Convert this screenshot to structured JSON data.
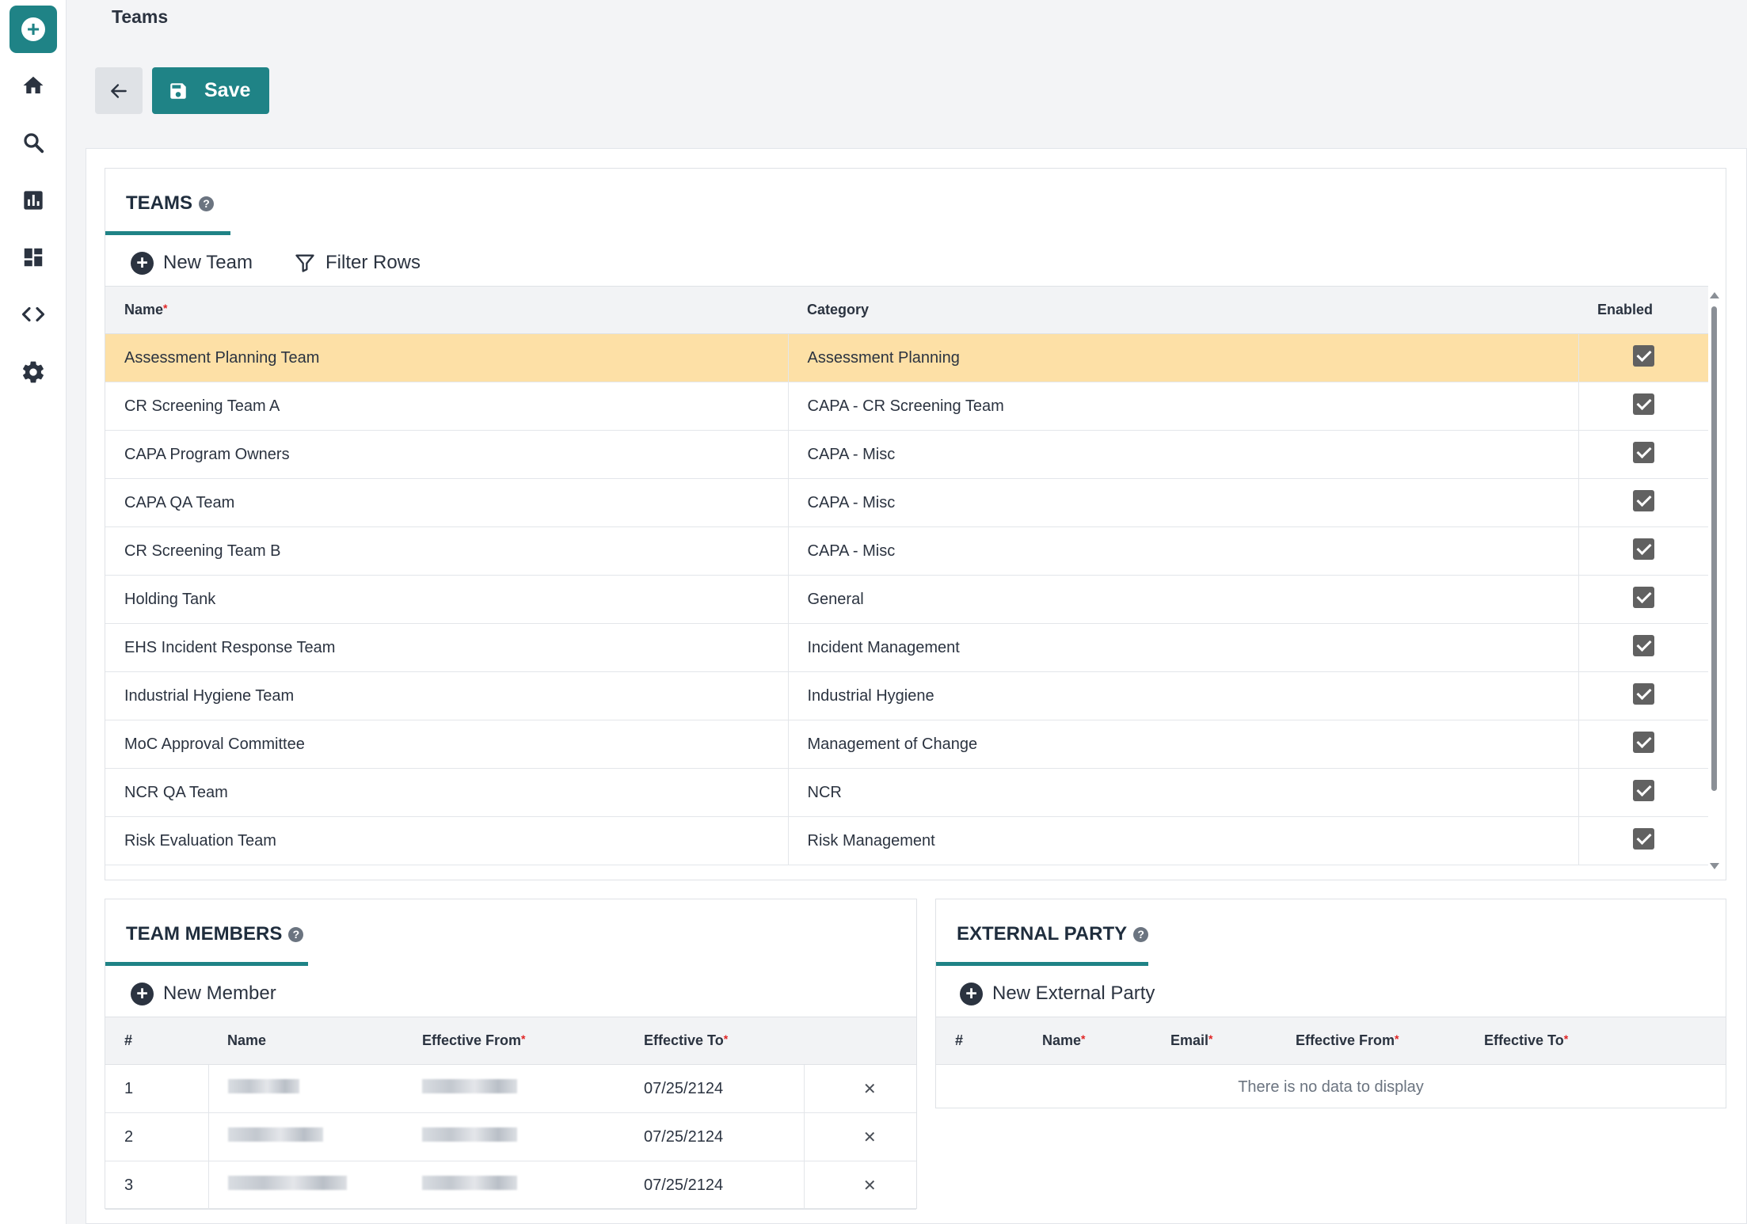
{
  "page": {
    "title": "Teams"
  },
  "toolbar": {
    "save_label": "Save"
  },
  "teams": {
    "title": "TEAMS",
    "new_label": "New Team",
    "filter_label": "Filter Rows",
    "columns": {
      "name": "Name",
      "category": "Category",
      "enabled": "Enabled"
    },
    "rows": [
      {
        "name": "Assessment Planning Team",
        "category": "Assessment Planning",
        "enabled": true,
        "selected": true
      },
      {
        "name": "CR Screening Team A",
        "category": "CAPA - CR Screening Team",
        "enabled": true
      },
      {
        "name": "CAPA Program Owners",
        "category": "CAPA - Misc",
        "enabled": true
      },
      {
        "name": "CAPA QA Team",
        "category": "CAPA - Misc",
        "enabled": true
      },
      {
        "name": "CR Screening Team B",
        "category": "CAPA - Misc",
        "enabled": true
      },
      {
        "name": "Holding Tank",
        "category": "General",
        "enabled": true
      },
      {
        "name": "EHS Incident Response Team",
        "category": "Incident Management",
        "enabled": true
      },
      {
        "name": "Industrial Hygiene Team",
        "category": "Industrial Hygiene",
        "enabled": true
      },
      {
        "name": "MoC Approval Committee",
        "category": "Management of Change",
        "enabled": true
      },
      {
        "name": "NCR QA Team",
        "category": "NCR",
        "enabled": true
      },
      {
        "name": "Risk Evaluation Team",
        "category": "Risk Management",
        "enabled": true
      }
    ]
  },
  "members": {
    "title": "TEAM MEMBERS",
    "new_label": "New Member",
    "columns": {
      "num": "#",
      "name": "Name",
      "from": "Effective From",
      "to": "Effective To"
    },
    "rows": [
      {
        "num": "1",
        "to": "07/25/2124"
      },
      {
        "num": "2",
        "to": "07/25/2124"
      },
      {
        "num": "3",
        "to": "07/25/2124"
      }
    ]
  },
  "external": {
    "title": "EXTERNAL PARTY",
    "new_label": "New External Party",
    "columns": {
      "num": "#",
      "name": "Name",
      "email": "Email",
      "from": "Effective From",
      "to": "Effective To"
    },
    "empty": "There is no data to display"
  }
}
